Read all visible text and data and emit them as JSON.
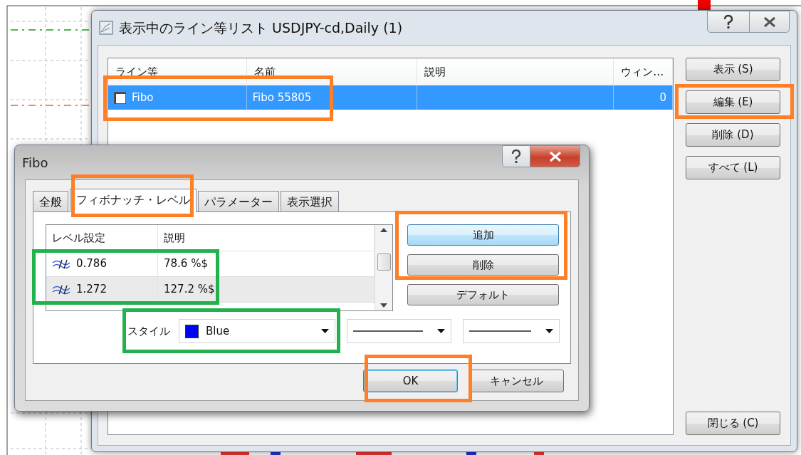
{
  "list_window": {
    "title": "表示中のライン等リスト USDJPY-cd,Daily (1)",
    "columns": [
      "ライン等",
      "名前",
      "説明",
      "ウィン…"
    ],
    "rows": [
      {
        "checked": false,
        "selected": true,
        "type": "Fibo",
        "name": "Fibo 55805",
        "window": "0"
      }
    ],
    "side_buttons": [
      "表示 (S)",
      "編集 (E)",
      "削除 (D)",
      "すべて (L)"
    ],
    "close_label": "閉じる (C)"
  },
  "fibo_dialog": {
    "title": "Fibo",
    "tabs": [
      {
        "label": "全般",
        "selected": false
      },
      {
        "label": "フィボナッチ・レベル",
        "selected": true
      },
      {
        "label": "パラメーター",
        "selected": false
      },
      {
        "label": "表示選択",
        "selected": false
      }
    ],
    "level_columns": [
      "レベル設定",
      "説明"
    ],
    "levels": [
      {
        "level": "0.786",
        "description": "78.6 %$"
      },
      {
        "level": "1.272",
        "description": "127.2 %$"
      }
    ],
    "level_buttons": [
      {
        "label": "追加",
        "focused": true
      },
      {
        "label": "削除",
        "focused": false
      },
      {
        "label": "デフォルト",
        "focused": false
      }
    ],
    "style": {
      "label": "スタイル",
      "color_name": "Blue",
      "color": "#0000ff"
    },
    "ok_label": "OK",
    "cancel_label": "キャンセル"
  },
  "annotations": [
    {
      "color": "#ff7f27"
    },
    {
      "color": "#ff7f27"
    },
    {
      "color": "#ff7f27"
    },
    {
      "color": "#ff7f27"
    },
    {
      "color": "#ff7f27"
    },
    {
      "color": "#22b14c"
    },
    {
      "color": "#22b14c"
    }
  ]
}
